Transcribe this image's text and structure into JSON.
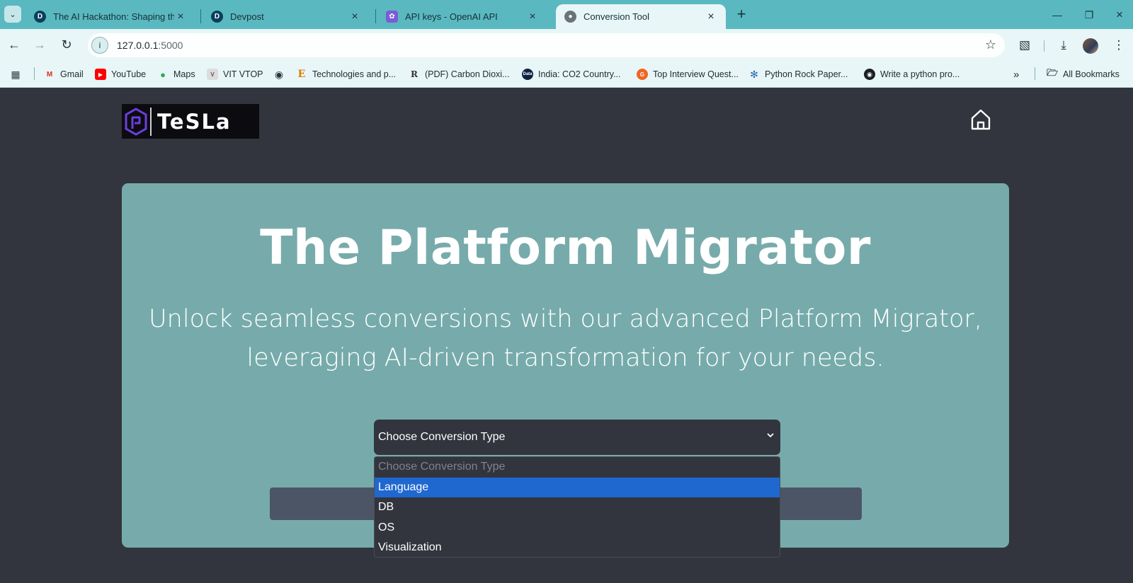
{
  "browser": {
    "tabs": [
      {
        "title": "The AI Hackathon: Shaping the",
        "favicon": "D",
        "active": false
      },
      {
        "title": "Devpost",
        "favicon": "D",
        "active": false
      },
      {
        "title": "API keys - OpenAI API",
        "favicon": "openai",
        "active": false
      },
      {
        "title": "Conversion Tool",
        "favicon": "globe",
        "active": true
      }
    ],
    "url_host": "127.0.0.1",
    "url_port": ":5000",
    "bookmarks": [
      {
        "label": "Gmail"
      },
      {
        "label": "YouTube"
      },
      {
        "label": "Maps"
      },
      {
        "label": "VIT VTOP"
      },
      {
        "label": ""
      },
      {
        "label": "Technologies and p..."
      },
      {
        "label": "(PDF) Carbon Dioxi..."
      },
      {
        "label": "India: CO2 Country..."
      },
      {
        "label": "Top Interview Quest..."
      },
      {
        "label": "Python Rock Paper..."
      },
      {
        "label": "Write a python pro..."
      }
    ],
    "all_bookmarks_label": "All Bookmarks",
    "colors": {
      "tabstrip": "#5ab8c0",
      "toolbar": "#e8f6f7"
    }
  },
  "page": {
    "logo_text": "TeSLa",
    "title": "The Platform Migrator",
    "subtitle": "Unlock seamless conversions with our advanced Platform Migrator, leveraging AI-driven transformation for your needs.",
    "select": {
      "value": "Choose Conversion Type",
      "options": [
        {
          "label": "Choose Conversion Type",
          "placeholder": true
        },
        {
          "label": "Language",
          "selected": true
        },
        {
          "label": "DB"
        },
        {
          "label": "OS"
        },
        {
          "label": "Visualization"
        }
      ]
    },
    "colors": {
      "background": "#32353e",
      "hero": "#77abab",
      "highlight": "#1f68d0",
      "button": "#4b5566"
    }
  }
}
